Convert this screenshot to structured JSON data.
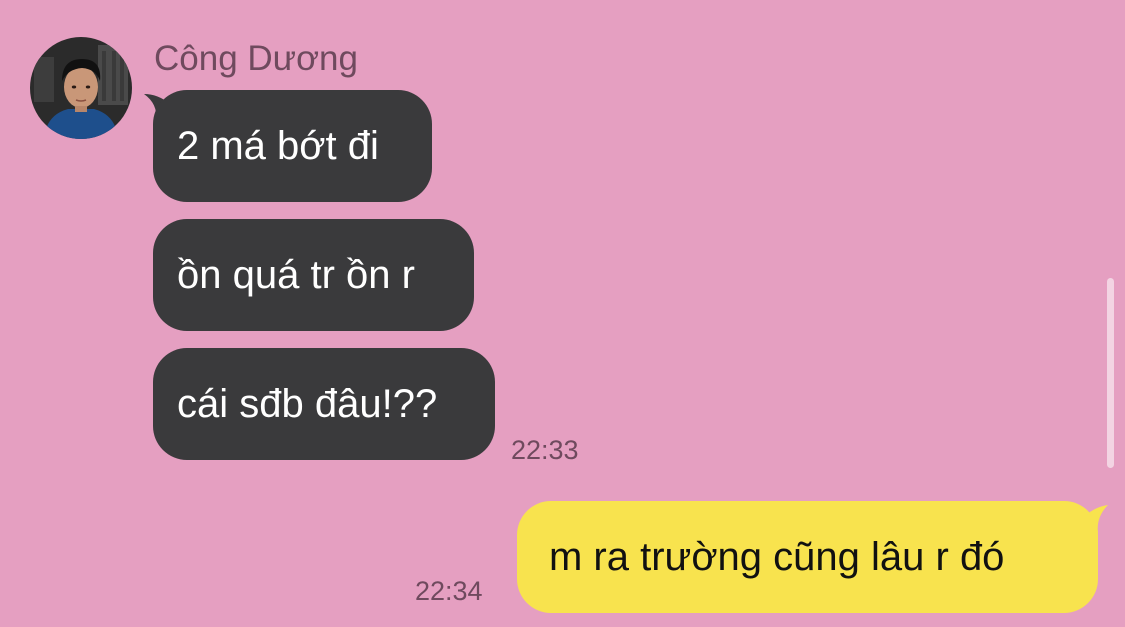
{
  "conversation": {
    "contact_name": "Công Dương",
    "avatar_icon": "contact-avatar",
    "incoming": [
      {
        "text": "2 má bớt đi"
      },
      {
        "text": "ồn quá tr ồn r"
      },
      {
        "text": "cái sđb đâu!??"
      }
    ],
    "incoming_time": "22:33",
    "outgoing": [
      {
        "text": "m ra trường cũng lâu r đó"
      }
    ],
    "outgoing_time": "22:34"
  },
  "colors": {
    "background": "#e59fc1",
    "incoming_bubble": "#3a3a3c",
    "outgoing_bubble": "#f8e34e"
  }
}
